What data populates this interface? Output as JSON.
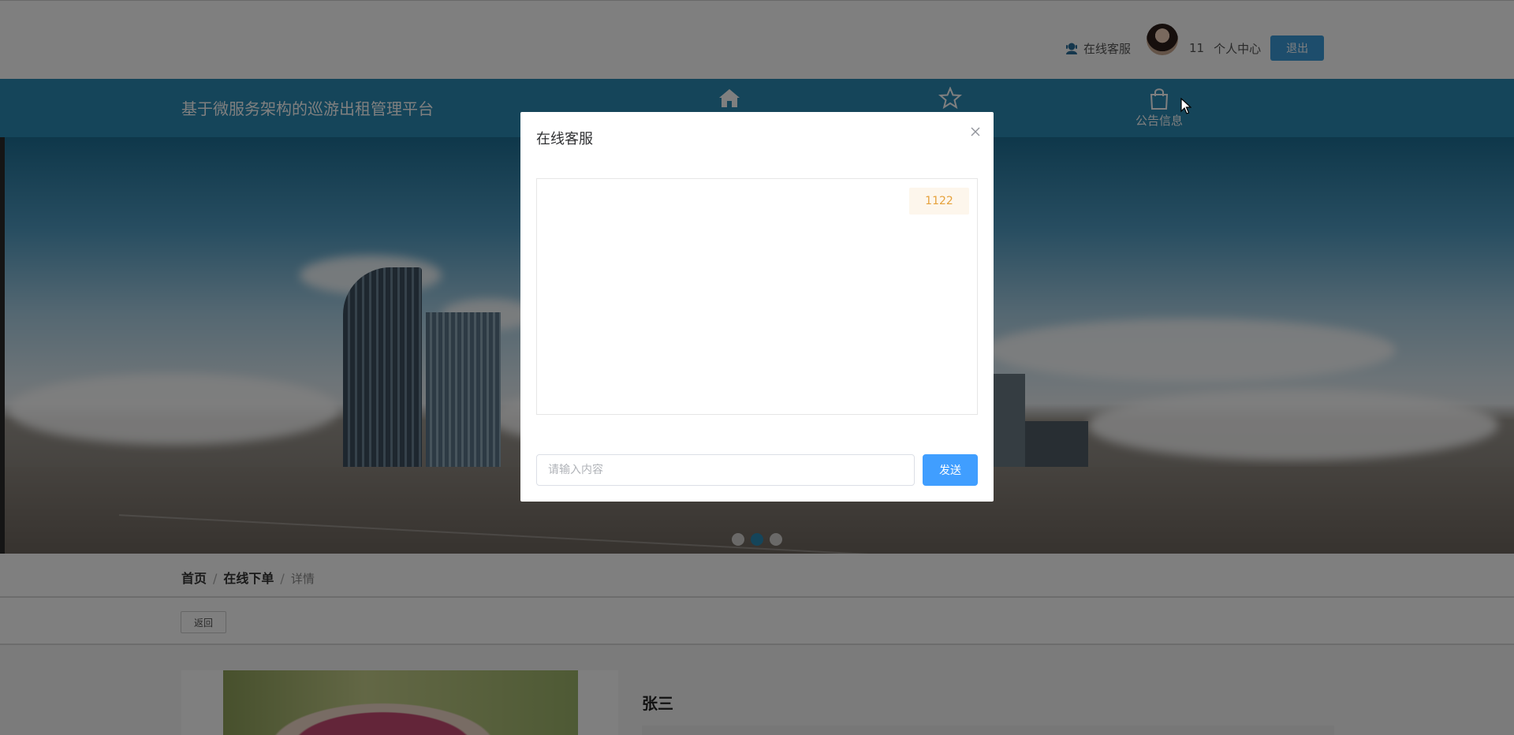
{
  "header": {
    "customer_service_label": "在线客服",
    "username": "11",
    "personal_center": "个人中心",
    "logout": "退出"
  },
  "nav": {
    "site_title": "基于微服务架构的巡游出租管理平台",
    "items": [
      {
        "label": "",
        "icon": "home-icon"
      },
      {
        "label": "",
        "icon": "star-icon"
      },
      {
        "label": "公告信息",
        "icon": "shopping-bag-icon"
      }
    ]
  },
  "banner": {
    "slide_count": 3,
    "active_slide": 2
  },
  "breadcrumb": {
    "items": [
      "首页",
      "在线下单",
      "详情"
    ]
  },
  "back_button": "返回",
  "detail": {
    "name": "张三"
  },
  "modal": {
    "title": "在线客服",
    "messages": [
      {
        "text": "1122"
      }
    ],
    "input_placeholder": "请输入内容",
    "send_label": "发送"
  },
  "colors": {
    "nav_bg": "#2b8ab4",
    "logout_bg": "#3a9ad9",
    "send_bg": "#409eff",
    "message_bg": "#fdf6ec",
    "message_text": "#e6a23c"
  }
}
